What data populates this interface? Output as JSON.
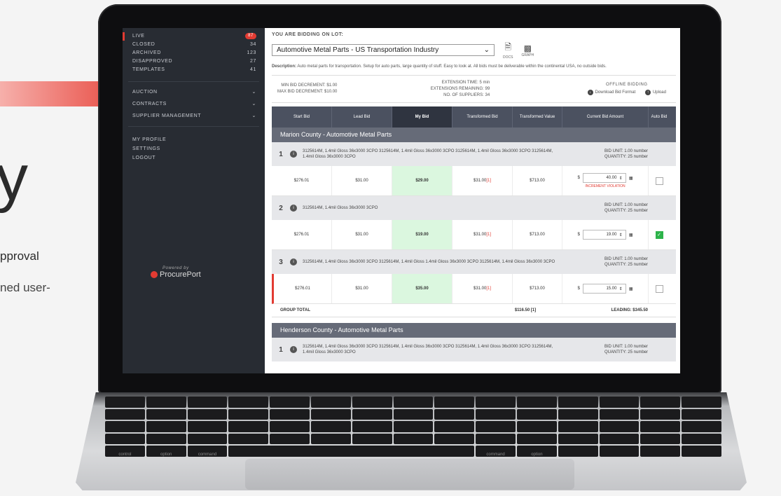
{
  "background": {
    "big_text": "y",
    "line1": "pproval",
    "line2": "ned user-"
  },
  "sidebar": {
    "statuses": [
      {
        "label": "LIVE",
        "count": "87"
      },
      {
        "label": "CLOSED",
        "count": "34"
      },
      {
        "label": "ARCHIVED",
        "count": "123"
      },
      {
        "label": "DISAPPROVED",
        "count": "27"
      },
      {
        "label": "TEMPLATES",
        "count": "41"
      }
    ],
    "menus": [
      "AUCTION",
      "CONTRACTS",
      "SUPPLIER MANAGEMENT"
    ],
    "links": [
      "MY PROFILE",
      "SETTINGS",
      "LOGOUT"
    ],
    "powered_by": "Powered by",
    "brand": "ProcurePort"
  },
  "lot": {
    "header": "YOU ARE BIDDING ON LOT:",
    "selected": "Automotive Metal Parts - US Transportation Industry",
    "docs_label": "DOCS",
    "graph_label": "GRAPH",
    "description_label": "Description:",
    "description": "Auto metal parts for transportation. Setup for auto parts, large quantity of stuff. Easy to look at. All bids must be deliverable within the continental USA, no outside bids."
  },
  "stats": {
    "min_dec_label": "MIN BID DECREMENT:",
    "min_dec": "$1.00",
    "max_dec_label": "MAX BID DECREMENT:",
    "max_dec": "$10.00",
    "ext_time_label": "EXTENSION TIME:",
    "ext_time": "5 min",
    "ext_rem_label": "EXTENSIONS REMAINING:",
    "ext_rem": "99",
    "suppliers_label": "NO. OF SUPPLIERS:",
    "suppliers": "34",
    "offline_title": "OFFLINE BIDDING",
    "download_label": "Download Bid Format",
    "upload_label": "Upload"
  },
  "table": {
    "headers": [
      "Start Bid",
      "Lead Bid",
      "My Bid",
      "Transformed Bid",
      "Transformed Value",
      "Current Bid Amount",
      "Auto Bid"
    ]
  },
  "groups": [
    {
      "title": "Marion County - Automotive Metal Parts",
      "items": [
        {
          "num": "1",
          "desc": "3125614M, 1.4mil Gloss 36x3000 3CPO 3125614M, 1.4mil Gloss 36x3000 3CPO 3125614M, 1.4mil Gloss 36x3000 3CPO 3125614M, 1.4mil Gloss 36x3000 3CPO",
          "unit": "BID UNIT:  1.00 number",
          "qty": "QUANTITY:  25 number",
          "start": "$276.01",
          "lead": "$31.00",
          "my": "$29.00",
          "transformed": "$31.00",
          "tflag": "[1]",
          "value": "$713.00",
          "amount": "40.00",
          "violation": "INCREMENT VIOLATION",
          "auto": false
        },
        {
          "num": "2",
          "desc": "3125614M, 1.4mil Gloss 36x3000 3CPO",
          "unit": "BID UNIT:  1.00 number",
          "qty": "QUANTITY:  25 number",
          "start": "$276.01",
          "lead": "$31.00",
          "my": "$19.00",
          "transformed": "$31.00",
          "tflag": "[1]",
          "value": "$713.00",
          "amount": "19.00",
          "violation": "",
          "auto": true
        },
        {
          "num": "3",
          "desc": "3125614M, 1.4mil Gloss 36x3000 3CPO 3125614M, 1.4mil Gloss 1.4mil Gloss 36x3000 3CPO 3125614M, 1.4mil Gloss 36x3000 3CPO",
          "unit": "BID UNIT:  1.00 number",
          "qty": "QUANTITY:  25 number",
          "start": "$276.01",
          "lead": "$31.00",
          "my": "$35.00",
          "transformed": "$31.00",
          "tflag": "[1]",
          "value": "$713.00",
          "amount": "15.00",
          "violation": "",
          "auto": false
        }
      ],
      "total_label": "GROUP TOTAL",
      "total_value": "$116.50 [1]",
      "leading": "LEADING:  $345.50"
    },
    {
      "title": "Henderson County - Automotive Metal Parts",
      "items": [
        {
          "num": "1",
          "desc": "3125614M, 1.4mil Gloss 36x3000 3CPO 3125614M, 1.4mil Gloss 36x3000 3CPO 3125614M, 1.4mil Gloss 36x3000 3CPO 3125614M, 1.4mil Gloss 36x3000 3CPO",
          "unit": "BID UNIT:  1.00 number",
          "qty": "QUANTITY:  25 number"
        }
      ]
    }
  ],
  "colors": {
    "accent": "#e23b32",
    "sidebar": "#282c33",
    "my_bid_bg": "#dbf7df",
    "auto_on": "#2db34a"
  },
  "keyboard": {
    "row4": [
      "control",
      "option",
      "command",
      "",
      "command",
      "option"
    ]
  }
}
